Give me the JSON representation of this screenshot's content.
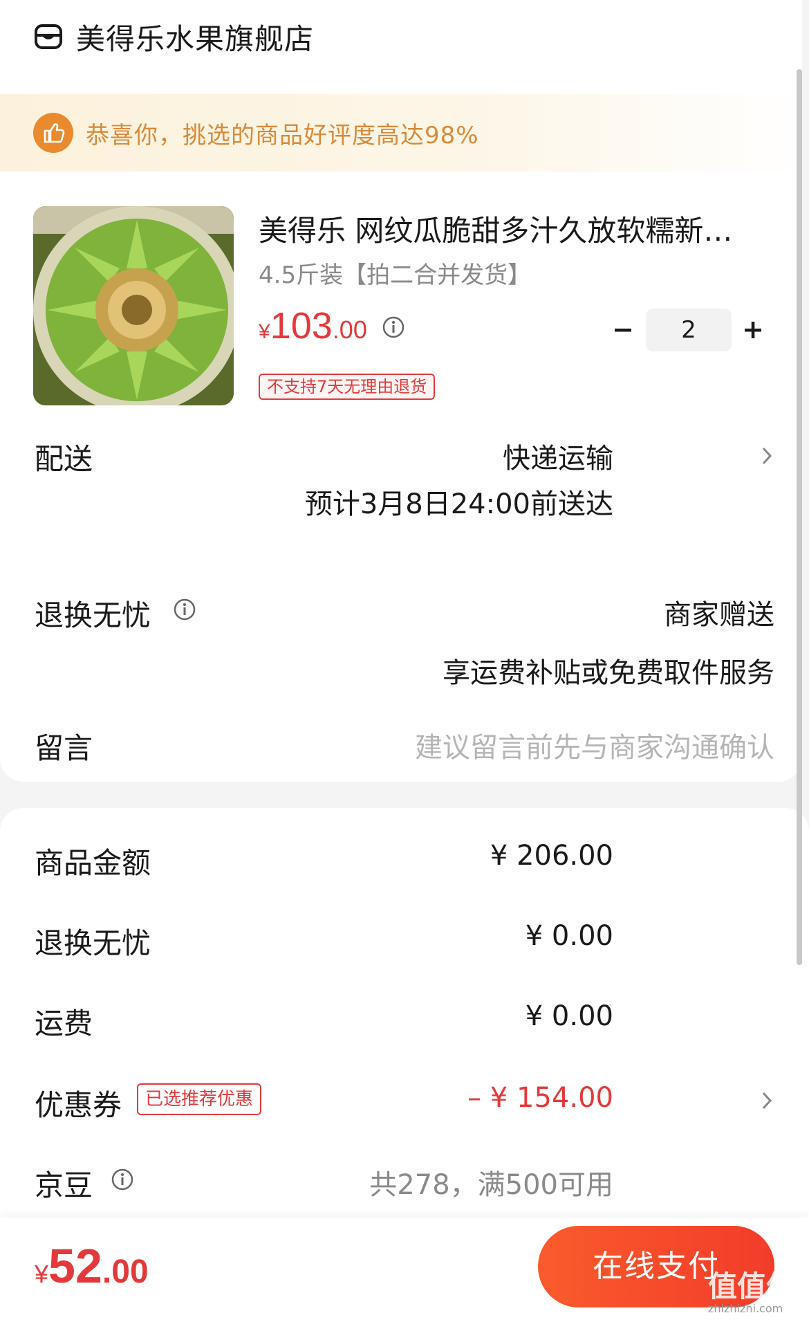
{
  "store": {
    "name": "美得乐水果旗舰店"
  },
  "banner": {
    "text": "恭喜你，挑选的商品好评度高达98%"
  },
  "product": {
    "title": "美得乐 网纹瓜脆甜多汁久放软糯新…",
    "spec": "4.5斤装【拍二合并发货】",
    "price_currency": "¥",
    "price_int": "103",
    "price_dec": ".00",
    "quantity": "2",
    "tag": "不支持7天无理由退货"
  },
  "delivery": {
    "label": "配送",
    "method": "快递运输",
    "eta": "预计3月8日24:00前送达"
  },
  "returns": {
    "label": "退换无忧",
    "value": "商家赠送",
    "desc": "享运费补贴或免费取件服务"
  },
  "message": {
    "label": "留言",
    "placeholder": "建议留言前先与商家沟通确认"
  },
  "summary": {
    "goods_label": "商品金额",
    "goods_value": "¥ 206.00",
    "returns_label": "退换无忧",
    "returns_value": "¥ 0.00",
    "shipping_label": "运费",
    "shipping_value": "¥ 0.00",
    "coupon_label": "优惠券",
    "coupon_tag": "已选推荐优惠",
    "coupon_value": "– ¥ 154.00",
    "beans_label": "京豆",
    "beans_value": "共278，满500可用"
  },
  "footer": {
    "total_currency": "¥",
    "total_int": "52",
    "total_dec": ".00",
    "pay_label": "在线支付",
    "watermark": "值值值",
    "watermark_url": "zhizhizhi.com"
  },
  "colors": {
    "accent": "#e4393c",
    "banner_text": "#d98a3a",
    "pay_button": "#f23c2a"
  },
  "icons": [
    "store-icon",
    "thumbs-up-icon",
    "info-icon",
    "minus-icon",
    "plus-icon",
    "chevron-right-icon"
  ]
}
